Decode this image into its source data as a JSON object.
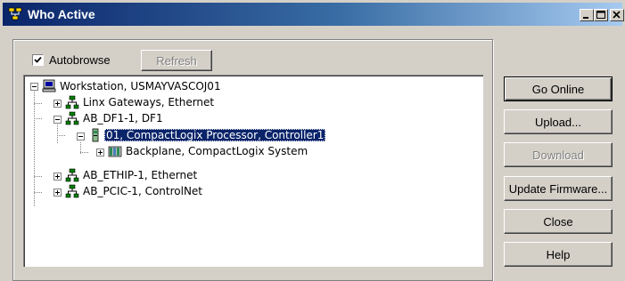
{
  "window": {
    "title": "Who Active"
  },
  "autobrowse": {
    "label": "Autobrowse",
    "checked": true
  },
  "refresh_button": {
    "label": "Refresh",
    "enabled": false
  },
  "tree": {
    "nodes": [
      {
        "label": "Workstation, USMAYVASCOJ01",
        "icon": "workstation-icon",
        "expanded": true
      },
      {
        "label": "Linx Gateways, Ethernet",
        "icon": "network-icon",
        "expanded": false
      },
      {
        "label": "AB_DF1-1, DF1",
        "icon": "network-icon",
        "expanded": true
      },
      {
        "label": "01, CompactLogix Processor, Controller1",
        "icon": "processor-icon",
        "expanded": true,
        "selected": true
      },
      {
        "label": "Backplane, CompactLogix System",
        "icon": "backplane-icon",
        "expanded": false
      },
      {
        "label": "AB_ETHIP-1, Ethernet",
        "icon": "network-icon",
        "expanded": false
      },
      {
        "label": "AB_PCIC-1, ControlNet",
        "icon": "network-icon",
        "expanded": false
      }
    ]
  },
  "buttons": {
    "go_online": "Go Online",
    "upload": "Upload...",
    "download": "Download",
    "update_firmware": "Update Firmware...",
    "close": "Close",
    "help": "Help"
  },
  "colors": {
    "titlebar_start": "#0a246a",
    "titlebar_end": "#a6caf0",
    "selection": "#0a246a",
    "face": "#d4d0c8"
  }
}
